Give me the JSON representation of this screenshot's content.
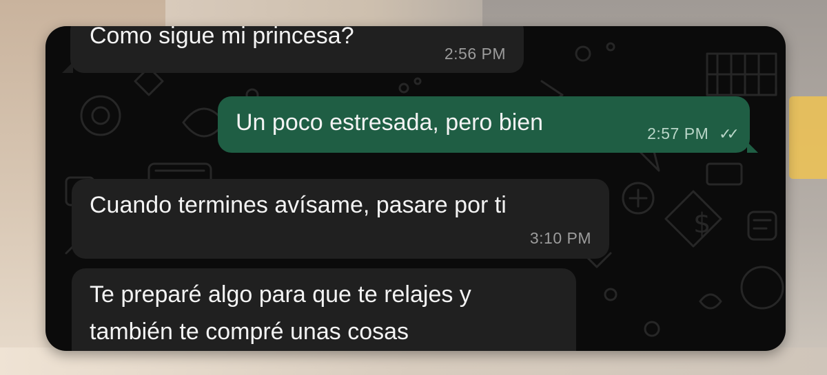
{
  "messages": [
    {
      "direction": "incoming",
      "text": "Como sigue mi princesa?",
      "time": "2:56 PM"
    },
    {
      "direction": "outgoing",
      "text": "Un poco estresada, pero bien",
      "time": "2:57 PM",
      "status_icon": "double-check-icon"
    },
    {
      "direction": "incoming",
      "text": "Cuando termines avísame, pasare por ti",
      "time": "3:10 PM"
    },
    {
      "direction": "incoming",
      "text_lines": [
        "Te preparé algo para que te relajes y",
        "también te compré unas cosas"
      ]
    }
  ],
  "colors": {
    "chat_background": "#0b0b0b",
    "incoming_bubble": "#202020",
    "outgoing_bubble": "#1f5e44",
    "text": "#f3f3f3",
    "timestamp": "#9c9c9c"
  }
}
